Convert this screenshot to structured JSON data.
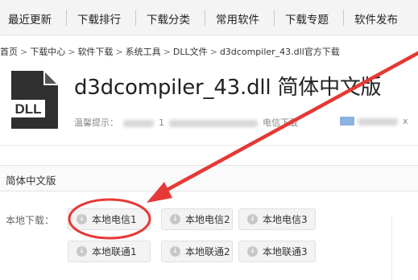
{
  "nav": {
    "items": [
      "最近更新",
      "下载排行",
      "下载分类",
      "常用软件",
      "下载专题",
      "软件发布"
    ]
  },
  "breadcrumb": [
    "首页",
    "下载中心",
    "软件下载",
    "系统工具",
    "DLL文件",
    "d3dcompiler_43.dll官方下载"
  ],
  "product": {
    "icon_label": "DLL",
    "title": "d3dcompiler_43.dll 简体中文版",
    "notice_prefix": "温馨提示：",
    "notice_mid": "1",
    "notice_suffix": "电信下载",
    "email_text": "x"
  },
  "section": {
    "version_label": "简体中文版",
    "local_download_label": "本地下载：",
    "buttons": [
      "本地电信1",
      "本地电信2",
      "本地电信3",
      "本地联通1",
      "本地联通2",
      "本地联通3"
    ]
  },
  "annotation": {
    "color": "#e53935",
    "highlighted": "本地电信1"
  },
  "colors": {
    "nav_bg": "#f4f4f4",
    "button_bg": "#f3f3f3",
    "icon_dark": "#2f2f2f"
  }
}
